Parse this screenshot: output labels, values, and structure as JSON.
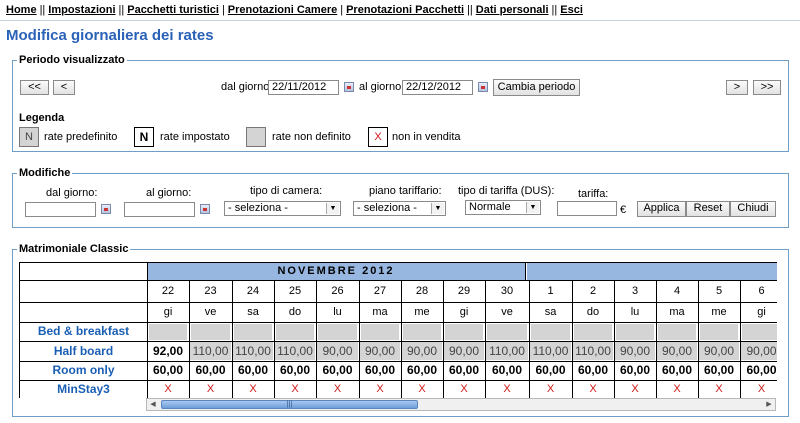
{
  "nav": {
    "items": [
      "Home",
      "Impostazioni",
      "Pacchetti turistici",
      "Prenotazioni Camere",
      "Prenotazioni Pacchetti",
      "Dati personali",
      "Esci"
    ],
    "separators": [
      "||",
      "||",
      "|",
      "|",
      "||",
      "||"
    ]
  },
  "page": {
    "title": "Modifica giornaliera dei rates"
  },
  "period": {
    "legend": "Periodo visualizzato",
    "prev_far": "<<",
    "prev": "<",
    "from_label": "dal giorno:",
    "from_value": "22/11/2012",
    "to_label": "al giorno:",
    "to_value": "22/12/2012",
    "change_button": "Cambia periodo",
    "next": ">",
    "next_far": ">>"
  },
  "legend_box": {
    "title": "Legenda",
    "items": [
      {
        "symbol": "N",
        "label": "rate predefinito"
      },
      {
        "symbol": "N",
        "label": "rate impostato"
      },
      {
        "symbol": "",
        "label": "rate non definito"
      },
      {
        "symbol": "X",
        "label": "non in vendita"
      }
    ]
  },
  "edits": {
    "legend": "Modifiche",
    "from_label": "dal giorno:",
    "to_label": "al giorno:",
    "room_type_label": "tipo di camera:",
    "room_type_value": "- seleziona -",
    "tariff_plan_label": "piano tariffario:",
    "tariff_plan_value": "- seleziona -",
    "tariff_type_label": "tipo di tariffa (DUS):",
    "tariff_type_value": "Normale",
    "rate_label": "tariffa:",
    "currency": "€",
    "apply": "Applica",
    "reset": "Reset",
    "close": "Chiudi"
  },
  "room": {
    "legend": "Matrimoniale Classic",
    "month_title": "NOVEMBRE 2012",
    "days": [
      {
        "num": "22",
        "dow": "gi"
      },
      {
        "num": "23",
        "dow": "ve"
      },
      {
        "num": "24",
        "dow": "sa"
      },
      {
        "num": "25",
        "dow": "do"
      },
      {
        "num": "26",
        "dow": "lu"
      },
      {
        "num": "27",
        "dow": "ma"
      },
      {
        "num": "28",
        "dow": "me"
      },
      {
        "num": "29",
        "dow": "gi"
      },
      {
        "num": "30",
        "dow": "ve"
      },
      {
        "num": "1",
        "dow": "sa"
      },
      {
        "num": "2",
        "dow": "do"
      },
      {
        "num": "3",
        "dow": "lu"
      },
      {
        "num": "4",
        "dow": "ma"
      },
      {
        "num": "5",
        "dow": "me"
      },
      {
        "num": "6",
        "dow": "gi"
      }
    ],
    "rows": [
      {
        "label": "Bed & breakfast",
        "kind": "empty",
        "values": []
      },
      {
        "label": "Half board",
        "kind": "rates",
        "values": [
          "92,00",
          "110,00",
          "110,00",
          "110,00",
          "90,00",
          "90,00",
          "90,00",
          "90,00",
          "110,00",
          "110,00",
          "110,00",
          "90,00",
          "90,00",
          "90,00",
          "90,00"
        ],
        "set_flags": [
          true,
          false,
          false,
          false,
          false,
          false,
          false,
          false,
          false,
          false,
          false,
          false,
          false,
          false,
          false
        ]
      },
      {
        "label": "Room only",
        "kind": "rates",
        "values": [
          "60,00",
          "60,00",
          "60,00",
          "60,00",
          "60,00",
          "60,00",
          "60,00",
          "60,00",
          "60,00",
          "60,00",
          "60,00",
          "60,00",
          "60,00",
          "60,00",
          "60,00"
        ],
        "set_flags": [
          true,
          true,
          true,
          true,
          true,
          true,
          true,
          true,
          true,
          true,
          true,
          true,
          true,
          true,
          true
        ]
      },
      {
        "label": "MinStay3",
        "kind": "x",
        "values": [
          "X",
          "X",
          "X",
          "X",
          "X",
          "X",
          "X",
          "X",
          "X",
          "X",
          "X",
          "X",
          "X",
          "X",
          "X"
        ]
      }
    ]
  },
  "colors": {
    "title": "#2a62b8",
    "month_band": "#97b6e0",
    "no_sale": "#d01818",
    "fieldset_border": "#6f9fc8"
  }
}
